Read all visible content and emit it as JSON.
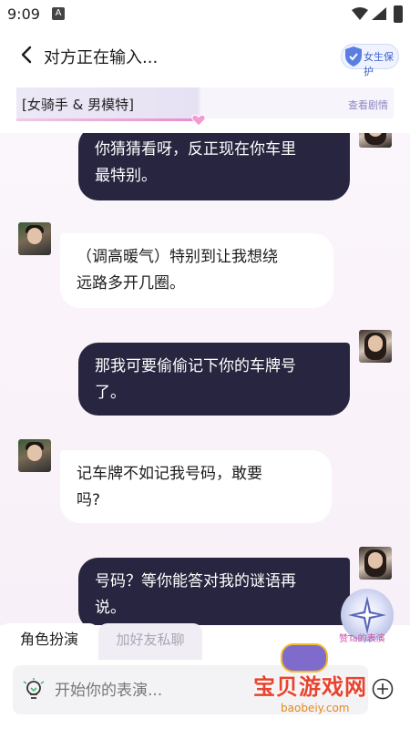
{
  "status_bar": {
    "time": "9:09",
    "notif_icon_letter": "A",
    "icons": [
      "wifi-icon",
      "cell-signal-icon",
      "battery-icon"
    ]
  },
  "header": {
    "title": "对方正在输入...",
    "badge": "女生保护"
  },
  "scene": {
    "title": "[女骑手 & 男模特]",
    "view_plot": "查看剧情"
  },
  "messages": [
    {
      "side": "out",
      "lines": [
        "你猜猜看呀，反正现在你车里",
        "最特别。"
      ]
    },
    {
      "side": "in",
      "lines": [
        "（调高暖气）特别到让我想绕",
        "远路多开几圈。"
      ]
    },
    {
      "side": "out",
      "lines": [
        "那我可要偷偷记下你的车牌号",
        "了。"
      ]
    },
    {
      "side": "in",
      "lines": [
        "记车牌不如记我号码，敢要",
        "吗?"
      ]
    },
    {
      "side": "out",
      "lines": [
        "号码？等你能答对我的谜语再",
        "说。"
      ]
    }
  ],
  "floating": {
    "label": "赞Ta的表演"
  },
  "tabs": {
    "active": "角色扮演",
    "inactive": "加好友私聊"
  },
  "input": {
    "placeholder": "开始你的表演..."
  },
  "watermark": {
    "title": "宝贝游戏网",
    "url": "baobeiy.com"
  }
}
